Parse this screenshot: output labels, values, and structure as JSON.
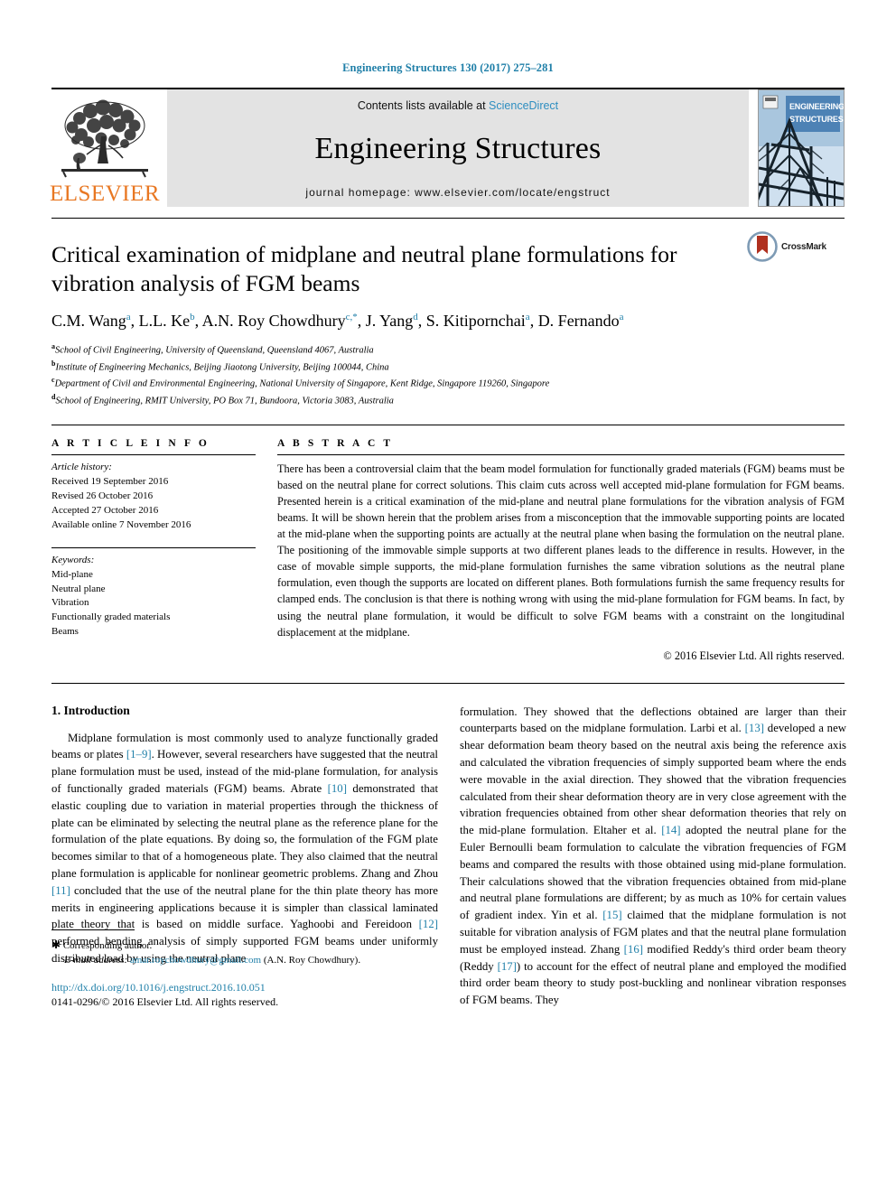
{
  "running_head": "Engineering Structures 130 (2017) 275–281",
  "masthead": {
    "publisher": "ELSEVIER",
    "contents_prefix": "Contents lists available at ",
    "contents_link": "ScienceDirect",
    "journal_title": "Engineering Structures",
    "homepage": "journal homepage: www.elsevier.com/locate/engstruct",
    "cover_line1": "ENGINEERING",
    "cover_line2": "STRUCTURES",
    "cover_sky_color": "#4d82b5"
  },
  "article": {
    "title": "Critical examination of midplane and neutral plane formulations for vibration analysis of FGM beams",
    "crossmark_label": "CrossMark",
    "authors_html": "C.M. Wang<sup>a</sup>, L.L. Ke<sup>b</sup>, A.N. Roy Chowdhury<sup>c,*</sup>, J. Yang<sup>d</sup>, S. Kitipornchai<sup>a</sup>, D. Fernando<sup>a</sup>",
    "affiliations": [
      {
        "marker": "a",
        "text": "School of Civil Engineering, University of Queensland, Queensland 4067, Australia"
      },
      {
        "marker": "b",
        "text": "Institute of Engineering Mechanics, Beijing Jiaotong University, Beijing 100044, China"
      },
      {
        "marker": "c",
        "text": "Department of Civil and Environmental Engineering, National University of Singapore, Kent Ridge, Singapore 119260, Singapore"
      },
      {
        "marker": "d",
        "text": "School of Engineering, RMIT University, PO Box 71, Bundoora, Victoria 3083, Australia"
      }
    ]
  },
  "article_info": {
    "heading": "A R T I C L E  I N F O",
    "history_label": "Article history:",
    "history": [
      "Received 19 September 2016",
      "Revised 26 October 2016",
      "Accepted 27 October 2016",
      "Available online 7 November 2016"
    ],
    "keywords_label": "Keywords:",
    "keywords": [
      "Mid-plane",
      "Neutral plane",
      "Vibration",
      "Functionally graded materials",
      "Beams"
    ]
  },
  "abstract": {
    "heading": "A B S T R A C T",
    "text": "There has been a controversial claim that the beam model formulation for functionally graded materials (FGM) beams must be based on the neutral plane for correct solutions. This claim cuts across well accepted mid-plane formulation for FGM beams. Presented herein is a critical examination of the mid-plane and neutral plane formulations for the vibration analysis of FGM beams. It will be shown herein that the problem arises from a misconception that the immovable supporting points are located at the mid-plane when the supporting points are actually at the neutral plane when basing the formulation on the neutral plane. The positioning of the immovable simple supports at two different planes leads to the difference in results. However, in the case of movable simple supports, the mid-plane formulation furnishes the same vibration solutions as the neutral plane formulation, even though the supports are located on different planes. Both formulations furnish the same frequency results for clamped ends. The conclusion is that there is nothing wrong with using the mid-plane formulation for FGM beams. In fact, by using the neutral plane formulation, it would be difficult to solve FGM beams with a constraint on the longitudinal displacement at the midplane.",
    "copyright": "© 2016 Elsevier Ltd. All rights reserved."
  },
  "body": {
    "section_title": "1. Introduction",
    "left_paragraph_html": "Midplane formulation is most commonly used to analyze functionally graded beams or plates <span class=\"ref\">[1–9]</span>. However, several researchers have suggested that the neutral plane formulation must be used, instead of the mid-plane formulation, for analysis of functionally graded materials (FGM) beams. Abrate <span class=\"ref\">[10]</span> demonstrated that elastic coupling due to variation in material properties through the thickness of plate can be eliminated by selecting the neutral plane as the reference plane for the formulation of the plate equations. By doing so, the formulation of the FGM plate becomes similar to that of a homogeneous plate. They also claimed that the neutral plane formulation is applicable for nonlinear geometric problems. Zhang and Zhou <span class=\"ref\">[11]</span> concluded that the use of the neutral plane for the thin plate theory has more merits in engineering applications because it is simpler than classical laminated plate theory that is based on middle surface. Yaghoobi and Fereidoon <span class=\"ref\">[12]</span> performed bending analysis of simply supported FGM beams under uniformly distributed load by using the neutral plane",
    "right_paragraph_html": "formulation. They showed that the deflections obtained are larger than their counterparts based on the midplane formulation. Larbi et al. <span class=\"ref\">[13]</span> developed a new shear deformation beam theory based on the neutral axis being the reference axis and calculated the vibration frequencies of simply supported beam where the ends were movable in the axial direction. They showed that the vibration frequencies calculated from their shear deformation theory are in very close agreement with the vibration frequencies obtained from other shear deformation theories that rely on the mid-plane formulation. Eltaher et al. <span class=\"ref\">[14]</span> adopted the neutral plane for the Euler Bernoulli beam formulation to calculate the vibration frequencies of FGM beams and compared the results with those obtained using mid-plane formulation. Their calculations showed that the vibration frequencies obtained from mid-plane and neutral plane formulations are different; by as much as 10% for certain values of gradient index. Yin et al. <span class=\"ref\">[15]</span> claimed that the midplane formulation is not suitable for vibration analysis of FGM plates and that the neutral plane formulation must be employed instead. Zhang <span class=\"ref\">[16]</span> modified Reddy's third order beam theory (Reddy <span class=\"ref\">[17]</span>) to account for the effect of neutral plane and employed the modified third order beam theory to study post-buckling and nonlinear vibration responses of FGM beams. They"
  },
  "footnote": {
    "corresponding": "Corresponding author.",
    "email_label": "E-mail address:",
    "email": "amar.roychowdhury@gmail.com",
    "email_owner": "(A.N. Roy Chowdhury).",
    "doi": "http://dx.doi.org/10.1016/j.engstruct.2016.10.051",
    "issn": "0141-0296/© 2016 Elsevier Ltd. All rights reserved."
  },
  "colors": {
    "link": "#1f7fa8",
    "elsevier_orange": "#E87722",
    "sciencedirect": "#2e8ec0"
  }
}
